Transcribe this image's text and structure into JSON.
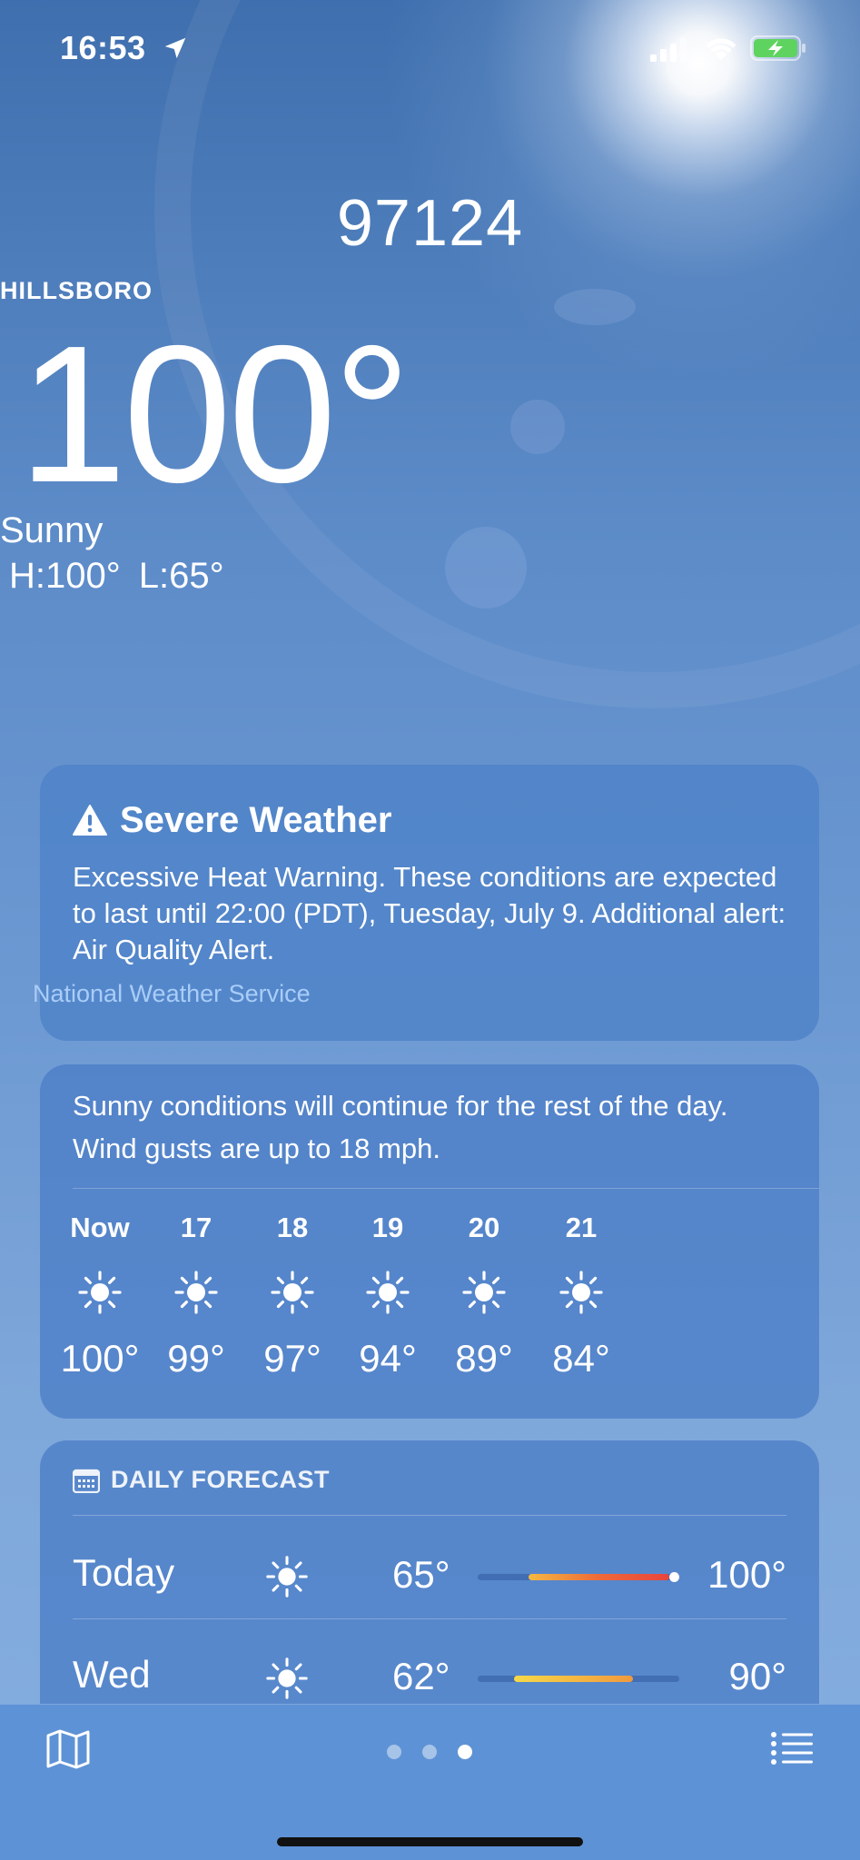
{
  "status_bar": {
    "time": "16:53",
    "icons": [
      "location-arrow-icon",
      "cellular-signal-icon",
      "wifi-icon",
      "battery-charging-icon"
    ],
    "battery_color": "#5fd35f"
  },
  "hero": {
    "location": "97124",
    "city": "HILLSBORO",
    "temperature": "100°",
    "condition": "Sunny",
    "high": "H:100°",
    "low": "L:65°"
  },
  "alert": {
    "title": "Severe Weather",
    "icon": "warning-triangle-icon",
    "body": "Excessive Heat Warning. These conditions are expected to last until 22:00 (PDT), Tuesday, July 9. Additional alert: Air Quality Alert.",
    "source": "National Weather Service"
  },
  "hourly": {
    "summary": "Sunny conditions will continue for the rest of the day. Wind gusts are up to 18 mph.",
    "hours": [
      {
        "label": "Now",
        "icon": "sun-icon",
        "temp": "100°"
      },
      {
        "label": "17",
        "icon": "sun-icon",
        "temp": "99°"
      },
      {
        "label": "18",
        "icon": "sun-icon",
        "temp": "97°"
      },
      {
        "label": "19",
        "icon": "sun-icon",
        "temp": "94°"
      },
      {
        "label": "20",
        "icon": "sun-icon",
        "temp": "89°"
      },
      {
        "label": "21",
        "icon": "sun-icon",
        "temp": "84°"
      }
    ]
  },
  "daily": {
    "title": "DAILY FORECAST",
    "icon": "calendar-icon",
    "days": [
      {
        "name": "Today",
        "icon": "sun-icon",
        "low": "65°",
        "high": "100°",
        "range_start": 0.25,
        "range_end": 0.95,
        "current": 0.97,
        "gradient": [
          "#f5b942",
          "#ee6a3a",
          "#e8453c"
        ]
      },
      {
        "name": "Wed",
        "icon": "sun-icon",
        "low": "62°",
        "high": "90°",
        "range_start": 0.18,
        "range_end": 0.77,
        "gradient": [
          "#f5d94a",
          "#f5b942",
          "#f09a3e"
        ]
      }
    ]
  },
  "bottom_bar": {
    "left_icon": "map-icon",
    "right_icon": "list-icon",
    "page_count": 3,
    "active_page": 3
  }
}
